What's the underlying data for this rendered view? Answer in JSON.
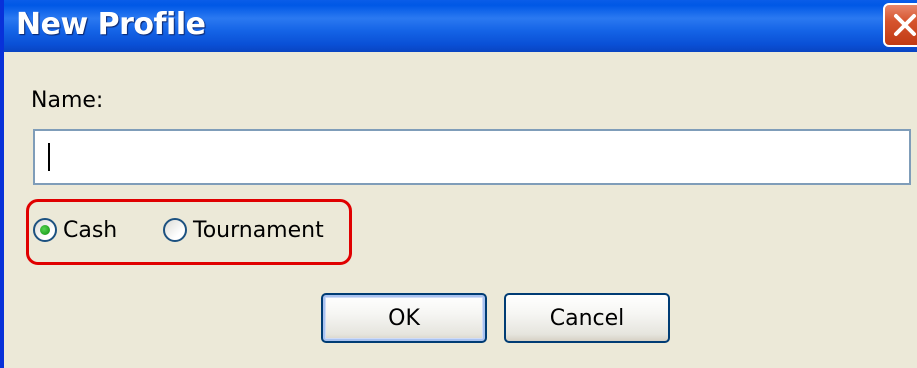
{
  "window": {
    "title": "New Profile",
    "close_icon": "close-x-icon"
  },
  "form": {
    "name_label": "Name:",
    "name_value": "",
    "profile_type": {
      "selected": "Cash",
      "options": [
        {
          "label": "Cash",
          "checked": true
        },
        {
          "label": "Tournament",
          "checked": false
        }
      ],
      "highlight_color": "#e00000"
    }
  },
  "buttons": {
    "ok_label": "OK",
    "cancel_label": "Cancel"
  },
  "colors": {
    "titlebar": "#0a50d6",
    "dialog_bg": "#ece9d8",
    "radio_checked": "#21a121"
  }
}
